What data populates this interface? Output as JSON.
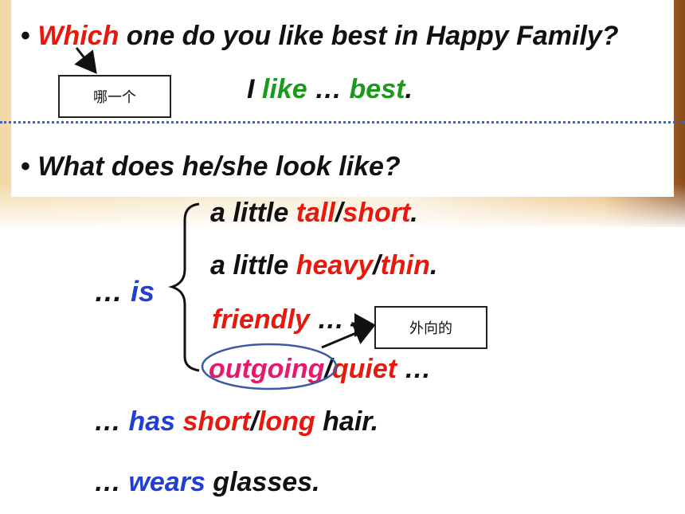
{
  "q1": {
    "bullet": "•",
    "which": "Which",
    "rest": " one do you like best in Happy Family?"
  },
  "box1": {
    "text": "哪一个"
  },
  "ans": {
    "i": "I ",
    "like": "like",
    "dots": " … ",
    "best": "best",
    "period": "."
  },
  "q2": {
    "bullet": "•",
    "text": "What does he/she look like?"
  },
  "lines": {
    "l1": {
      "pre": "a little ",
      "tall": "tall",
      "slash": "/",
      "short": "short",
      "end": "."
    },
    "l2": {
      "pre": "a little ",
      "heavy": "heavy",
      "slash": "/",
      "thin": "thin",
      "end": "."
    },
    "l3": {
      "friendly": "friendly",
      "dots": " …"
    },
    "l4": {
      "outgoing": "outgoing",
      "slash": "/",
      "quiet": "quiet",
      "dots": " …"
    }
  },
  "is": {
    "dots": "… ",
    "word": "is"
  },
  "box2": {
    "text": "外向的"
  },
  "has": {
    "dots": "… ",
    "has": "has",
    "short": "short",
    "slash": "/",
    "long": "long",
    "hair": " hair."
  },
  "wears": {
    "dots": "… ",
    "wears": "wears",
    "glasses": " glasses."
  },
  "colors": {
    "red": "#e8180c",
    "green": "#1a9a1a",
    "blue": "#1f3fd6",
    "pink": "#e8186a",
    "circle": "#3b5aa6"
  }
}
